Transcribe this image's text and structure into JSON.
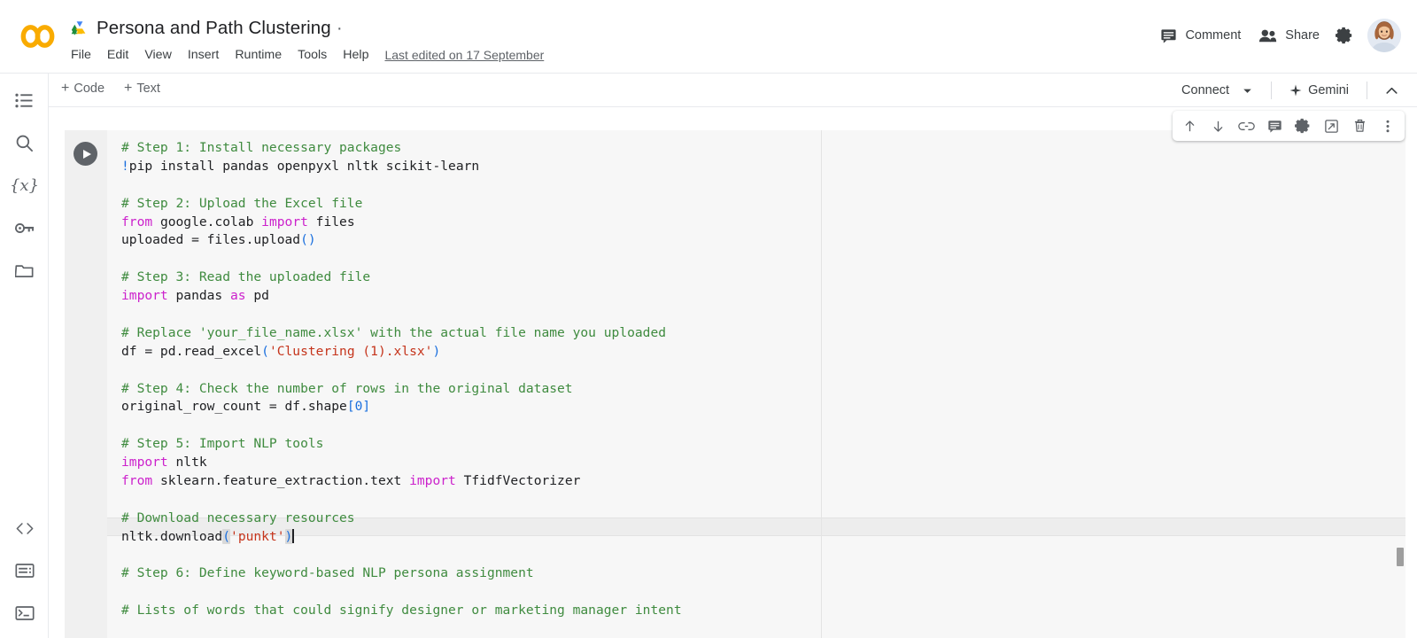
{
  "app": {
    "name": "Google Colab",
    "logo_text": "CO"
  },
  "header": {
    "drive_icon": "google-drive-icon",
    "doc_title": "Persona and Path Clustering",
    "doc_title_suffix": "·",
    "menu": [
      {
        "label": "File"
      },
      {
        "label": "Edit"
      },
      {
        "label": "View"
      },
      {
        "label": "Insert"
      },
      {
        "label": "Runtime"
      },
      {
        "label": "Tools"
      },
      {
        "label": "Help"
      }
    ],
    "last_edited": "Last edited on 17 September",
    "comment_label": "Comment",
    "comment_icon": "comment-icon",
    "share_label": "Share",
    "share_icon": "people-icon",
    "settings_icon": "gear-icon",
    "avatar": "user-avatar"
  },
  "toolbar": {
    "add_code_label": "Code",
    "add_text_label": "Text",
    "plus": "+",
    "connect_label": "Connect",
    "connect_caret_icon": "chevron-down-icon",
    "gemini_label": "Gemini",
    "gemini_icon": "sparkle-icon",
    "collapse_icon": "chevron-up-icon"
  },
  "sidebar": {
    "top_items": [
      {
        "name": "table-of-contents",
        "icon": "list-icon"
      },
      {
        "name": "search",
        "icon": "search-icon"
      },
      {
        "name": "variables",
        "icon": "variables-icon",
        "glyph": "{x}"
      },
      {
        "name": "secrets",
        "icon": "key-icon"
      },
      {
        "name": "files",
        "icon": "folder-icon"
      }
    ],
    "bottom_items": [
      {
        "name": "code-snippets",
        "icon": "code-brackets-icon",
        "glyph": "<>"
      },
      {
        "name": "command-palette",
        "icon": "command-palette-icon"
      },
      {
        "name": "terminal",
        "icon": "terminal-icon"
      }
    ]
  },
  "cell": {
    "run_button": "run-cell-button",
    "toolbar_icons": [
      {
        "name": "move-cell-up-button",
        "icon": "arrow-up-icon"
      },
      {
        "name": "move-cell-down-button",
        "icon": "arrow-down-icon"
      },
      {
        "name": "copy-cell-link-button",
        "icon": "link-icon"
      },
      {
        "name": "add-comment-button",
        "icon": "comment-icon"
      },
      {
        "name": "cell-settings-button",
        "icon": "gear-icon"
      },
      {
        "name": "mirror-cell-button",
        "icon": "open-in-new-icon"
      },
      {
        "name": "delete-cell-button",
        "icon": "trash-icon"
      },
      {
        "name": "more-cell-actions-button",
        "icon": "kebab-menu-icon"
      }
    ],
    "code_lines": [
      {
        "tokens": [
          {
            "t": "# Step 1: Install necessary packages",
            "c": "cm"
          }
        ]
      },
      {
        "tokens": [
          {
            "t": "!",
            "c": "bang"
          },
          {
            "t": "pip install pandas openpyxl nltk scikit-learn",
            "c": "op"
          }
        ]
      },
      {
        "tokens": [
          {
            "t": "",
            "c": "op"
          }
        ]
      },
      {
        "tokens": [
          {
            "t": "# Step 2: Upload the Excel file",
            "c": "cm"
          }
        ]
      },
      {
        "tokens": [
          {
            "t": "from",
            "c": "kw"
          },
          {
            "t": " google.colab ",
            "c": "op"
          },
          {
            "t": "import",
            "c": "kw"
          },
          {
            "t": " files",
            "c": "op"
          }
        ]
      },
      {
        "tokens": [
          {
            "t": "uploaded = files.upload",
            "c": "op"
          },
          {
            "t": "()",
            "c": "pn"
          }
        ]
      },
      {
        "tokens": [
          {
            "t": "",
            "c": "op"
          }
        ]
      },
      {
        "tokens": [
          {
            "t": "# Step 3: Read the uploaded file",
            "c": "cm"
          }
        ]
      },
      {
        "tokens": [
          {
            "t": "import",
            "c": "kw"
          },
          {
            "t": " pandas ",
            "c": "op"
          },
          {
            "t": "as",
            "c": "kw"
          },
          {
            "t": " pd",
            "c": "op"
          }
        ]
      },
      {
        "tokens": [
          {
            "t": "",
            "c": "op"
          }
        ]
      },
      {
        "tokens": [
          {
            "t": "# Replace 'your_file_name.xlsx' with the actual file name you uploaded",
            "c": "cm"
          }
        ]
      },
      {
        "tokens": [
          {
            "t": "df = pd.read_excel",
            "c": "op"
          },
          {
            "t": "(",
            "c": "pn"
          },
          {
            "t": "'Clustering (1).xlsx'",
            "c": "st"
          },
          {
            "t": ")",
            "c": "pn"
          }
        ]
      },
      {
        "tokens": [
          {
            "t": "",
            "c": "op"
          }
        ]
      },
      {
        "tokens": [
          {
            "t": "# Step 4: Check the number of rows in the original dataset",
            "c": "cm"
          }
        ]
      },
      {
        "tokens": [
          {
            "t": "original_row_count = df.shape",
            "c": "op"
          },
          {
            "t": "[",
            "c": "pn"
          },
          {
            "t": "0",
            "c": "pn"
          },
          {
            "t": "]",
            "c": "pn"
          }
        ]
      },
      {
        "tokens": [
          {
            "t": "",
            "c": "op"
          }
        ]
      },
      {
        "tokens": [
          {
            "t": "# Step 5: Import NLP tools",
            "c": "cm"
          }
        ]
      },
      {
        "tokens": [
          {
            "t": "import",
            "c": "kw"
          },
          {
            "t": " nltk",
            "c": "op"
          }
        ]
      },
      {
        "tokens": [
          {
            "t": "from",
            "c": "kw"
          },
          {
            "t": " sklearn.feature_extraction.text ",
            "c": "op"
          },
          {
            "t": "import",
            "c": "kw"
          },
          {
            "t": " TfidfVectorizer",
            "c": "op"
          }
        ]
      },
      {
        "tokens": [
          {
            "t": "",
            "c": "op"
          }
        ]
      },
      {
        "tokens": [
          {
            "t": "# Download necessary resources",
            "c": "cm"
          }
        ]
      },
      {
        "tokens": [
          {
            "t": "nltk.download",
            "c": "op"
          },
          {
            "t": "(",
            "c": "pn",
            "hl": true
          },
          {
            "t": "'punkt'",
            "c": "st"
          },
          {
            "t": ")",
            "c": "pn",
            "hl": true
          },
          {
            "t": "",
            "c": "caret"
          }
        ]
      },
      {
        "tokens": [
          {
            "t": "",
            "c": "op"
          }
        ]
      },
      {
        "tokens": [
          {
            "t": "# Step 6: Define keyword-based NLP persona assignment",
            "c": "cm"
          }
        ]
      },
      {
        "tokens": [
          {
            "t": "",
            "c": "op"
          }
        ]
      },
      {
        "tokens": [
          {
            "t": "# Lists of words that could signify designer or marketing manager intent",
            "c": "cm"
          }
        ]
      }
    ],
    "active_line_index": 21,
    "scrollbar": "vertical-scrollbar-thumb"
  },
  "colors": {
    "comment": "#3f8b3f",
    "keyword": "#cc22cc",
    "string": "#c5341b",
    "paren": "#1a6fde",
    "text": "#202124",
    "editor_bg": "#f7f7f7",
    "gutter_bg": "#f0f0f0",
    "colab_orange": "#f9ab00"
  }
}
